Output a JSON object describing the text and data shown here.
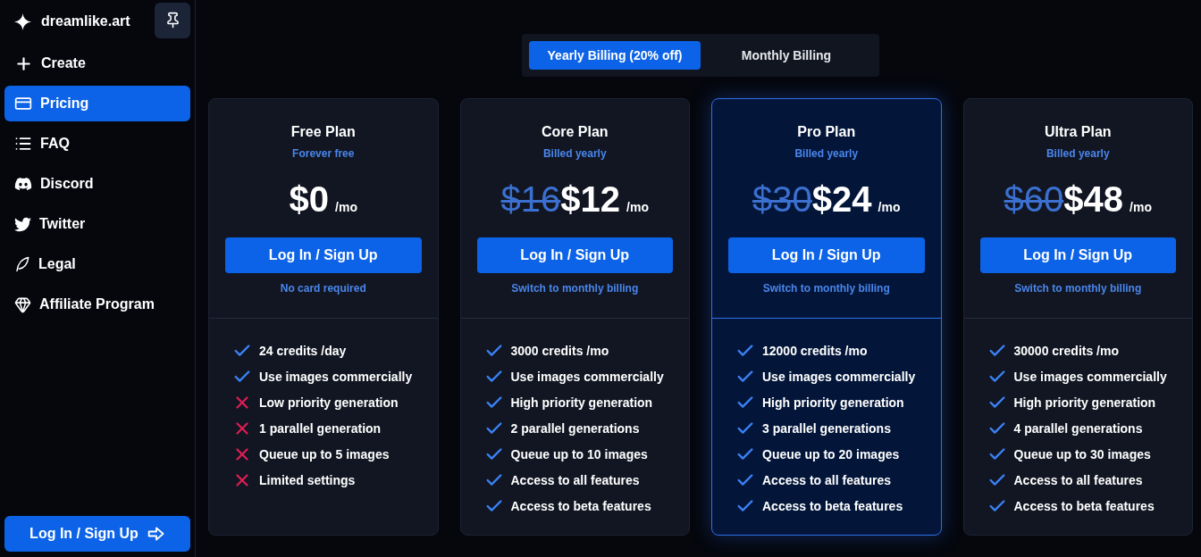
{
  "sidebar": {
    "logo": "dreamlike.art",
    "items": [
      {
        "label": "Create",
        "selected": false
      },
      {
        "label": "Pricing",
        "selected": true
      },
      {
        "label": "FAQ",
        "selected": false
      },
      {
        "label": "Discord",
        "selected": false
      },
      {
        "label": "Twitter",
        "selected": false
      },
      {
        "label": "Legal",
        "selected": false
      },
      {
        "label": "Affiliate Program",
        "selected": false
      }
    ],
    "login_button": "Log In / Sign Up"
  },
  "billing_toggle": [
    {
      "label": "Yearly Billing (20% off)",
      "selected": true
    },
    {
      "label": "Monthly Billing",
      "selected": false
    }
  ],
  "plans": [
    {
      "name": "Free Plan",
      "subtitle": "Forever free",
      "price": "$0",
      "period": "/mo",
      "button": "Log In / Sign Up",
      "note": "No card required",
      "highlighted": false,
      "features": [
        {
          "text": "24 credits /day",
          "included": true
        },
        {
          "text": "Use images commercially",
          "included": true
        },
        {
          "text": "Low priority generation",
          "included": false
        },
        {
          "text": "1 parallel generation",
          "included": false
        },
        {
          "text": "Queue up to 5 images",
          "included": false
        },
        {
          "text": "Limited settings",
          "included": false
        }
      ]
    },
    {
      "name": "Core Plan",
      "subtitle": "Billed yearly",
      "old_price": "$16",
      "price": "$12",
      "period": "/mo",
      "button": "Log In / Sign Up",
      "note": "Switch to monthly billing",
      "highlighted": false,
      "features": [
        {
          "text": "3000 credits /mo",
          "included": true
        },
        {
          "text": "Use images commercially",
          "included": true
        },
        {
          "text": "High priority generation",
          "included": true
        },
        {
          "text": "2 parallel generations",
          "included": true
        },
        {
          "text": "Queue up to 10 images",
          "included": true
        },
        {
          "text": "Access to all features",
          "included": true
        },
        {
          "text": "Access to beta features",
          "included": true
        }
      ]
    },
    {
      "name": "Pro Plan",
      "subtitle": "Billed yearly",
      "old_price": "$30",
      "price": "$24",
      "period": "/mo",
      "button": "Log In / Sign Up",
      "note": "Switch to monthly billing",
      "highlighted": true,
      "features": [
        {
          "text": "12000 credits /mo",
          "included": true
        },
        {
          "text": "Use images commercially",
          "included": true
        },
        {
          "text": "High priority generation",
          "included": true
        },
        {
          "text": "3 parallel generations",
          "included": true
        },
        {
          "text": "Queue up to 20 images",
          "included": true
        },
        {
          "text": "Access to all features",
          "included": true
        },
        {
          "text": "Access to beta features",
          "included": true
        }
      ]
    },
    {
      "name": "Ultra Plan",
      "subtitle": "Billed yearly",
      "old_price": "$60",
      "price": "$48",
      "period": "/mo",
      "button": "Log In / Sign Up",
      "note": "Switch to monthly billing",
      "highlighted": false,
      "features": [
        {
          "text": "30000 credits /mo",
          "included": true
        },
        {
          "text": "Use images commercially",
          "included": true
        },
        {
          "text": "High priority generation",
          "included": true
        },
        {
          "text": "4 parallel generations",
          "included": true
        },
        {
          "text": "Queue up to 30 images",
          "included": true
        },
        {
          "text": "Access to all features",
          "included": true
        },
        {
          "text": "Access to beta features",
          "included": true
        }
      ]
    }
  ]
}
